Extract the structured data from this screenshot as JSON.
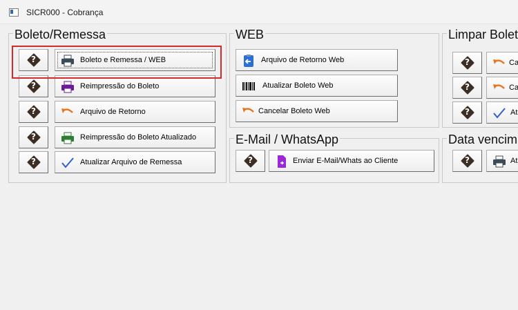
{
  "window": {
    "title": "SICR000 - Cobrança"
  },
  "groups": {
    "boleto": {
      "title": "Boleto/Remessa",
      "buttons": [
        "Boleto e Remessa  / WEB",
        "Reimpressão do Boleto",
        "Arquivo de Retorno",
        "Reimpressão do Boleto Atualizado",
        "Atualizar Arquivo de Remessa"
      ]
    },
    "web": {
      "title": "WEB",
      "buttons": [
        "Arquivo de Retorno Web",
        "Atualizar Boleto Web",
        "Cancelar Boleto Web"
      ]
    },
    "email": {
      "title": "E-Mail / WhatsApp",
      "buttons": [
        "Enviar E-Mail/Whats ao Cliente"
      ]
    },
    "limpar": {
      "title": "Limpar Bolet",
      "buttons": [
        "Ca",
        "Ca",
        "At"
      ]
    },
    "data": {
      "title": "Data vencim",
      "buttons": [
        "At"
      ]
    }
  },
  "help_symbol": "?",
  "colors": {
    "highlight": "#d42a2a",
    "print_dark": "#3d4a57",
    "print_purple": "#6a1b9a",
    "print_green": "#2e7d32",
    "retorno_orange": "#e8731a",
    "check_blue": "#2f5ec9"
  }
}
